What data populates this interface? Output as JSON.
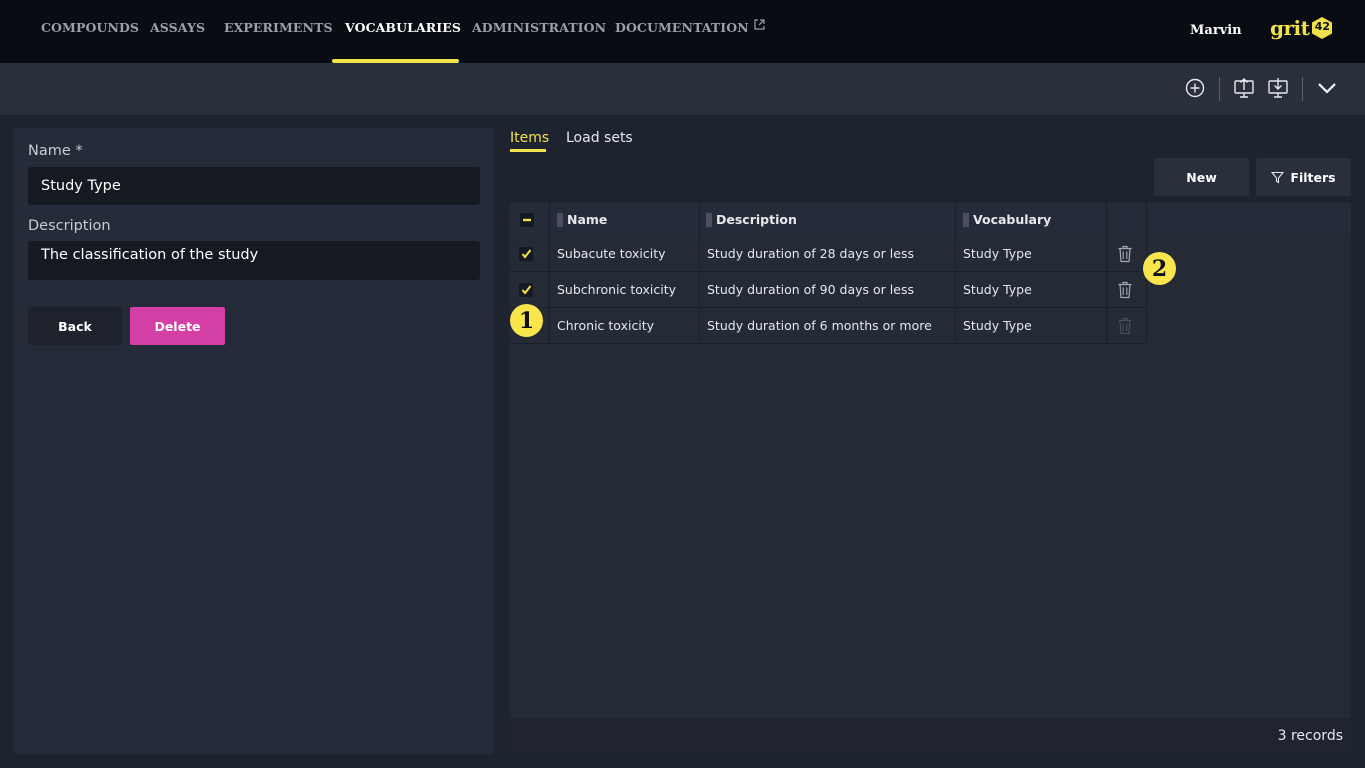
{
  "nav": {
    "items": [
      {
        "label": "COMPOUNDS"
      },
      {
        "label": "ASSAYS"
      },
      {
        "label": "EXPERIMENTS"
      },
      {
        "label": "VOCABULARIES"
      },
      {
        "label": "ADMINISTRATION"
      },
      {
        "label": "DOCUMENTATION"
      }
    ],
    "active": "VOCABULARIES",
    "user": "Marvin",
    "logo_text": "grit",
    "logo_badge": "42"
  },
  "toolbar": {
    "icons": [
      "plus-circle-icon",
      "upload-icon",
      "download-icon",
      "chevron-down-icon"
    ]
  },
  "form": {
    "name_label": "Name *",
    "name_value": "Study Type",
    "description_label": "Description",
    "description_value": "The classification of the study",
    "back_label": "Back",
    "delete_label": "Delete"
  },
  "tabs": [
    {
      "label": "Items"
    },
    {
      "label": "Load sets"
    }
  ],
  "actions": {
    "new_label": "New",
    "filters_label": "Filters"
  },
  "table": {
    "columns": [
      {
        "label": "Name"
      },
      {
        "label": "Description"
      },
      {
        "label": "Vocabulary"
      }
    ],
    "rows": [
      {
        "name": "Subacute toxicity",
        "description": "Study duration of 28 days or less",
        "vocabulary": "Study Type",
        "checked": true
      },
      {
        "name": "Subchronic toxicity",
        "description": "Study duration of 90 days or less",
        "vocabulary": "Study Type",
        "checked": true
      },
      {
        "name": "Chronic toxicity",
        "description": "Study duration of 6 months or more",
        "vocabulary": "Study Type",
        "checked": false
      }
    ],
    "record_count": "3 records"
  },
  "callouts": {
    "first": "1",
    "second": "2"
  },
  "colors": {
    "accent": "#f2e24a",
    "danger": "#d43fa5",
    "nav_bg": "#090c12"
  }
}
